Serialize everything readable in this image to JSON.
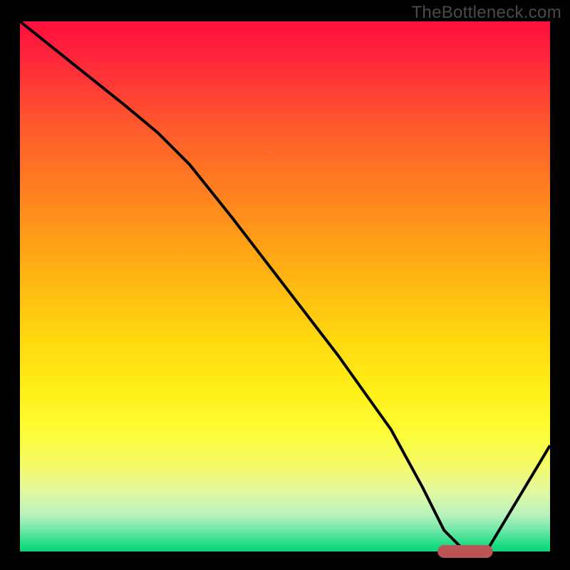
{
  "watermark": "TheBottleneck.com",
  "chart_data": {
    "type": "line",
    "title": "",
    "xlabel": "",
    "ylabel": "",
    "xlim": [
      0,
      100
    ],
    "ylim": [
      0,
      100
    ],
    "series": [
      {
        "name": "bottleneck-curve",
        "x": [
          0,
          10,
          20,
          26,
          32,
          40,
          50,
          60,
          70,
          76,
          80,
          84,
          88,
          100
        ],
        "y": [
          100,
          92,
          84,
          79,
          73,
          63,
          50,
          37,
          23,
          12,
          4,
          0,
          0,
          20
        ]
      }
    ],
    "marker": {
      "name": "optimal-range",
      "x_start": 80,
      "x_end": 88,
      "y": 0
    },
    "colors": {
      "curve": "#000000",
      "marker": "#bb5454",
      "gradient_top": "#ff0e3d",
      "gradient_bottom": "#0fd478"
    }
  }
}
